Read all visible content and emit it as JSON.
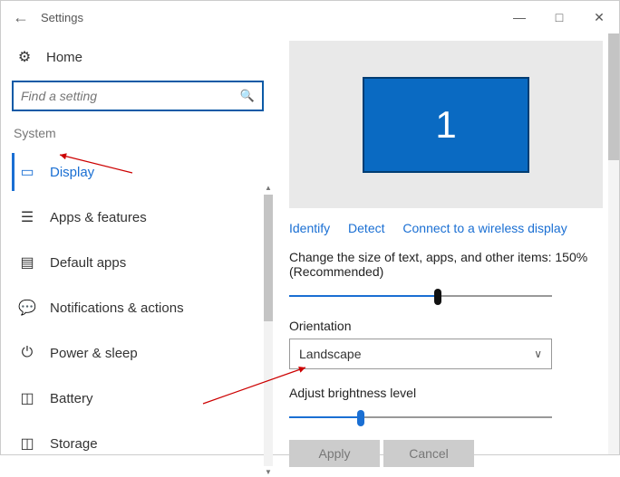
{
  "titlebar": {
    "title": "Settings"
  },
  "sidebar": {
    "home": "Home",
    "search_placeholder": "Find a setting",
    "section": "System",
    "items": [
      {
        "label": "Display"
      },
      {
        "label": "Apps & features"
      },
      {
        "label": "Default apps"
      },
      {
        "label": "Notifications & actions"
      },
      {
        "label": "Power & sleep"
      },
      {
        "label": "Battery"
      },
      {
        "label": "Storage"
      }
    ]
  },
  "main": {
    "monitor_number": "1",
    "links": {
      "identify": "Identify",
      "detect": "Detect",
      "wireless": "Connect to a wireless display"
    },
    "scale_label": "Change the size of text, apps, and other items: 150% (Recommended)",
    "orientation_label": "Orientation",
    "orientation_value": "Landscape",
    "brightness_label": "Adjust brightness level",
    "apply": "Apply",
    "cancel": "Cancel"
  }
}
